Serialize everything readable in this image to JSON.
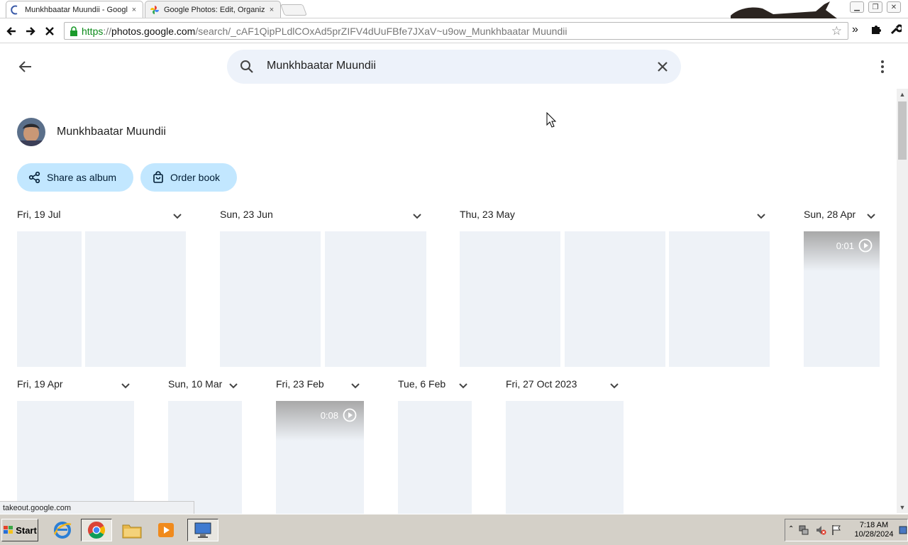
{
  "browser": {
    "tabs": [
      {
        "title": "Munkhbaatar Muundii - Google Photos",
        "active": true
      },
      {
        "title": "Google Photos: Edit, Organize, Search",
        "active": false
      }
    ],
    "close_glyph": "×",
    "url_https": "https",
    "url_sep": "://",
    "url_host": "photos.google.com",
    "url_rest": "/search/_cAF1QipPLdlCOxAd5prZIFV4dUuFBfe7JXaV~u9ow_Munkhbaatar Muundii"
  },
  "search": {
    "query": "Munkhbaatar Muundii"
  },
  "person": {
    "name": "Munkhbaatar Muundii"
  },
  "actions": {
    "share_label": "Share as album",
    "order_label": "Order book"
  },
  "date_groups": [
    {
      "label": "Fri, 19 Jul",
      "items": [
        {
          "type": "photo"
        },
        {
          "type": "photo"
        }
      ]
    },
    {
      "label": "Sun, 23 Jun",
      "items": [
        {
          "type": "photo"
        },
        {
          "type": "photo"
        }
      ]
    },
    {
      "label": "Thu, 23 May",
      "items": [
        {
          "type": "photo"
        },
        {
          "type": "photo"
        },
        {
          "type": "photo"
        }
      ]
    },
    {
      "label": "Sun, 28 Apr",
      "items": [
        {
          "type": "video",
          "duration": "0:01"
        }
      ]
    },
    {
      "label": "Fri, 19 Apr",
      "items": [
        {
          "type": "photo"
        }
      ]
    },
    {
      "label": "Sun, 10 Mar",
      "items": [
        {
          "type": "photo"
        }
      ]
    },
    {
      "label": "Fri, 23 Feb",
      "items": [
        {
          "type": "video",
          "duration": "0:08"
        }
      ]
    },
    {
      "label": "Tue, 6 Feb",
      "items": [
        {
          "type": "photo"
        }
      ]
    },
    {
      "label": "Fri, 27 Oct 2023",
      "items": [
        {
          "type": "photo"
        }
      ]
    }
  ],
  "status_url": "takeout.google.com",
  "taskbar": {
    "start_label": "Start",
    "time": "7:18 AM",
    "date": "10/28/2024"
  },
  "colors": {
    "search_bg": "#edf2fa",
    "chip_bg": "#c2e7ff",
    "thumb_placeholder": "#eef2f7",
    "url_https": "#0b8a19"
  }
}
